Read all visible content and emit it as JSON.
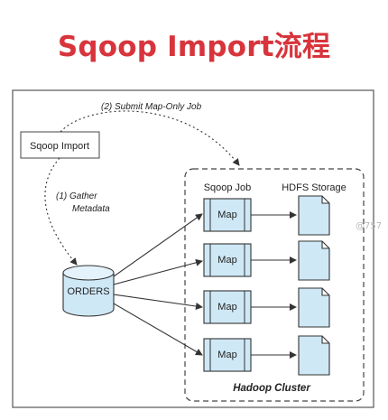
{
  "title": "Sqoop Import流程",
  "diagram": {
    "client_label": "Sqoop Import",
    "step_submit": "(2) Submit Map-Only Job",
    "step_gather_line1": "(1) Gather",
    "step_gather_line2": "Metadata",
    "database_label": "ORDERS",
    "col_job": "Sqoop Job",
    "col_storage": "HDFS Storage",
    "cluster_label": "Hadoop Cluster",
    "map_labels": [
      "Map",
      "Map",
      "Map",
      "Map"
    ],
    "watermark": "@757",
    "colors": {
      "title": "#d8343c",
      "shape_fill": "#cfe8f6",
      "stroke": "#333333"
    }
  }
}
